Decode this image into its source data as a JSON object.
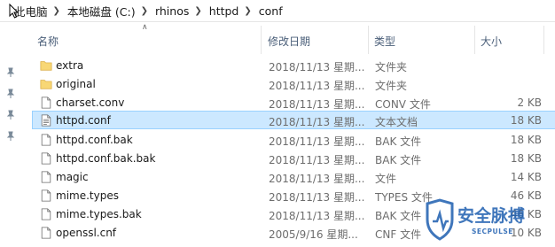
{
  "breadcrumb": {
    "items": [
      "此电脑",
      "本地磁盘 (C:)",
      "rhinos",
      "httpd",
      "conf"
    ]
  },
  "columns": {
    "name": "名称",
    "date": "修改日期",
    "type": "类型",
    "size": "大小"
  },
  "files": [
    {
      "name": "extra",
      "date": "2018/11/13 星期...",
      "type": "文件夹",
      "size": "",
      "icon": "folder-icon"
    },
    {
      "name": "original",
      "date": "2018/11/13 星期...",
      "type": "文件夹",
      "size": "",
      "icon": "folder-icon"
    },
    {
      "name": "charset.conv",
      "date": "2018/11/13 星期...",
      "type": "CONV 文件",
      "size": "2 KB",
      "icon": "file-icon"
    },
    {
      "name": "httpd.conf",
      "date": "2018/11/13 星期...",
      "type": "文本文档",
      "size": "18 KB",
      "icon": "text-file-icon",
      "selected": true
    },
    {
      "name": "httpd.conf.bak",
      "date": "2018/11/13 星期...",
      "type": "BAK 文件",
      "size": "18 KB",
      "icon": "file-icon"
    },
    {
      "name": "httpd.conf.bak.bak",
      "date": "2018/11/13 星期...",
      "type": "BAK 文件",
      "size": "18 KB",
      "icon": "file-icon"
    },
    {
      "name": "magic",
      "date": "2018/11/13 星期...",
      "type": "文件",
      "size": "14 KB",
      "icon": "file-icon"
    },
    {
      "name": "mime.types",
      "date": "2018/11/13 星期...",
      "type": "TYPES 文件",
      "size": "46 KB",
      "icon": "file-icon"
    },
    {
      "name": "mime.types.bak",
      "date": "2018/11/13 星期...",
      "type": "BAK 文件",
      "size": "46 KB",
      "icon": "file-icon"
    },
    {
      "name": "openssl.cnf",
      "date": "2005/9/16 星期...",
      "type": "CNF 文件",
      "size": "10 KB",
      "icon": "file-icon"
    }
  ],
  "watermark": {
    "brand": "安全脉搏",
    "sub": "SECPULSE"
  },
  "colors": {
    "selection_bg": "#cce8ff",
    "selection_border": "#99d1ff",
    "folder": "#f8d775",
    "header_text": "#4c607a",
    "watermark": "#1e5fb0"
  }
}
